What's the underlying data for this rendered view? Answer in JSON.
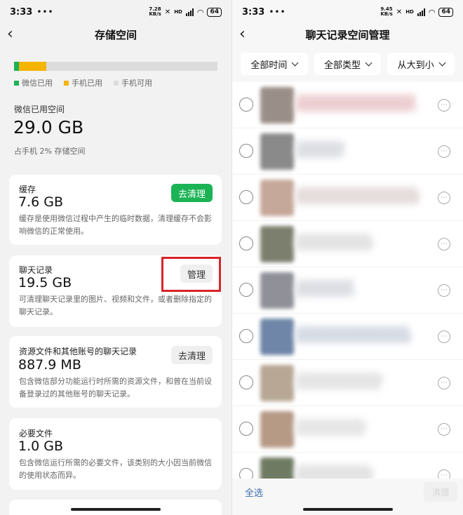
{
  "left": {
    "status": {
      "time": "3:33",
      "dots": "•••",
      "speed_top": "7.28",
      "speed_bottom": "KB/s",
      "network": "HD",
      "battery": "64"
    },
    "nav": {
      "back_icon": "chevron-left-icon",
      "title": "存储空间"
    },
    "usage_bar": {
      "wechat_fraction": 0.024,
      "phone_fraction": 0.134,
      "colors": {
        "wechat": "#1bb354",
        "phone": "#f5b400",
        "free": "#dcdcdc"
      }
    },
    "legend": [
      {
        "label": "微信已用",
        "color": "#1bb354"
      },
      {
        "label": "手机已用",
        "color": "#f5b400"
      },
      {
        "label": "手机可用",
        "color": "#dcdcdc"
      }
    ],
    "summary": {
      "label": "微信已用空间",
      "total": "29.0 GB",
      "percent_text": "占手机 2% 存储空间"
    },
    "cards": [
      {
        "title": "缓存",
        "size": "7.6 GB",
        "desc": "缓存是使用微信过程中产生的临时数据，清理缓存不会影响微信的正常使用。",
        "button": "去清理",
        "button_style": "green"
      },
      {
        "title": "聊天记录",
        "size": "19.5 GB",
        "desc": "可清理聊天记录里的图片、视频和文件，或者删除指定的聊天记录。",
        "button": "管理",
        "button_style": "gray"
      },
      {
        "title": "资源文件和其他账号的聊天记录",
        "size": "887.9 MB",
        "desc": "包含微信部分功能运行时所需的资源文件，和曾在当前设备登录过的其他账号的聊天记录。",
        "button": "去清理",
        "button_style": "gray"
      },
      {
        "title": "必要文件",
        "size": "1.0 GB",
        "desc": "包含微信运行所需的必要文件，该类别的大小因当前微信的使用状态而异。"
      }
    ]
  },
  "right": {
    "status": {
      "time": "3:33",
      "dots": "•••",
      "speed_top": "9.45",
      "speed_bottom": "KB/s",
      "network": "HD",
      "battery": "64"
    },
    "nav": {
      "back_icon": "chevron-left-icon",
      "title": "聊天记录空间管理"
    },
    "filters": [
      {
        "label": "全部时间"
      },
      {
        "label": "全部类型"
      },
      {
        "label": "从大到小"
      }
    ],
    "rows": [
      {
        "thumb": "#9a8f88",
        "text_width": 0.86,
        "text_color": "#d99aa0"
      },
      {
        "thumb": "#8a8a8a",
        "text_width": 0.35,
        "text_color": "#b9bcc5"
      },
      {
        "thumb": "#c6a89a",
        "text_width": 0.88,
        "text_color": "#c9b6b4"
      },
      {
        "thumb": "#7d7f6e",
        "text_width": 0.55,
        "text_color": "#c5c5c5"
      },
      {
        "thumb": "#8f9098",
        "text_width": 0.42,
        "text_color": "#b8bcc8"
      },
      {
        "thumb": "#6f86a8",
        "text_width": 0.82,
        "text_color": "#a9b4c8"
      },
      {
        "thumb": "#b7a794",
        "text_width": 0.62,
        "text_color": "#c8c8c8"
      },
      {
        "thumb": "#b79a86",
        "text_width": 0.5,
        "text_color": "#cbcbcb"
      },
      {
        "thumb": "#6f7a63",
        "text_width": 0.55,
        "text_color": "#c5c5c5"
      }
    ],
    "bottom": {
      "select_all": "全选",
      "clean_button": "清理"
    }
  }
}
